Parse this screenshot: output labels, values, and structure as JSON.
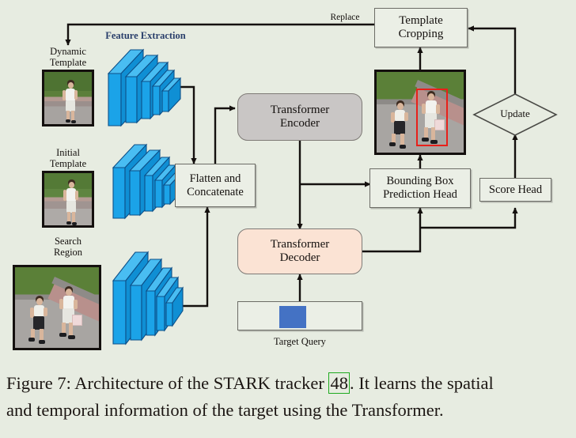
{
  "figure": {
    "background_color": "#e7ece1",
    "accent_blue": "#1f6fc4",
    "label_blue": "#2a3f6b",
    "box_gray": "#c9c6c5",
    "box_peach": "#fbe3d4",
    "bbox_red": "#e8201a",
    "query_blue": "#4472c4"
  },
  "labels": {
    "feature_extraction": "Feature Extraction",
    "dynamic_template": "Dynamic\nTemplate",
    "initial_template": "Initial\nTemplate",
    "search_region": "Search\nRegion",
    "target_query": "Target Query",
    "replace": "Replace",
    "update": "Update"
  },
  "nodes": {
    "flatten_concat": "Flatten and\nConcatenate",
    "transformer_encoder": "Transformer\nEncoder",
    "transformer_decoder": "Transformer\nDecoder",
    "template_cropping": "Template\nCropping",
    "bounding_box_head": "Bounding Box\nPrediction Head",
    "score_head": "Score Head"
  },
  "caption": {
    "line1_a": "Figure 7:  Architecture of the STARK tracker ",
    "citation": "48",
    "line1_b": ". It learns the spatial",
    "line2": "and temporal information of the target using the Transformer."
  }
}
